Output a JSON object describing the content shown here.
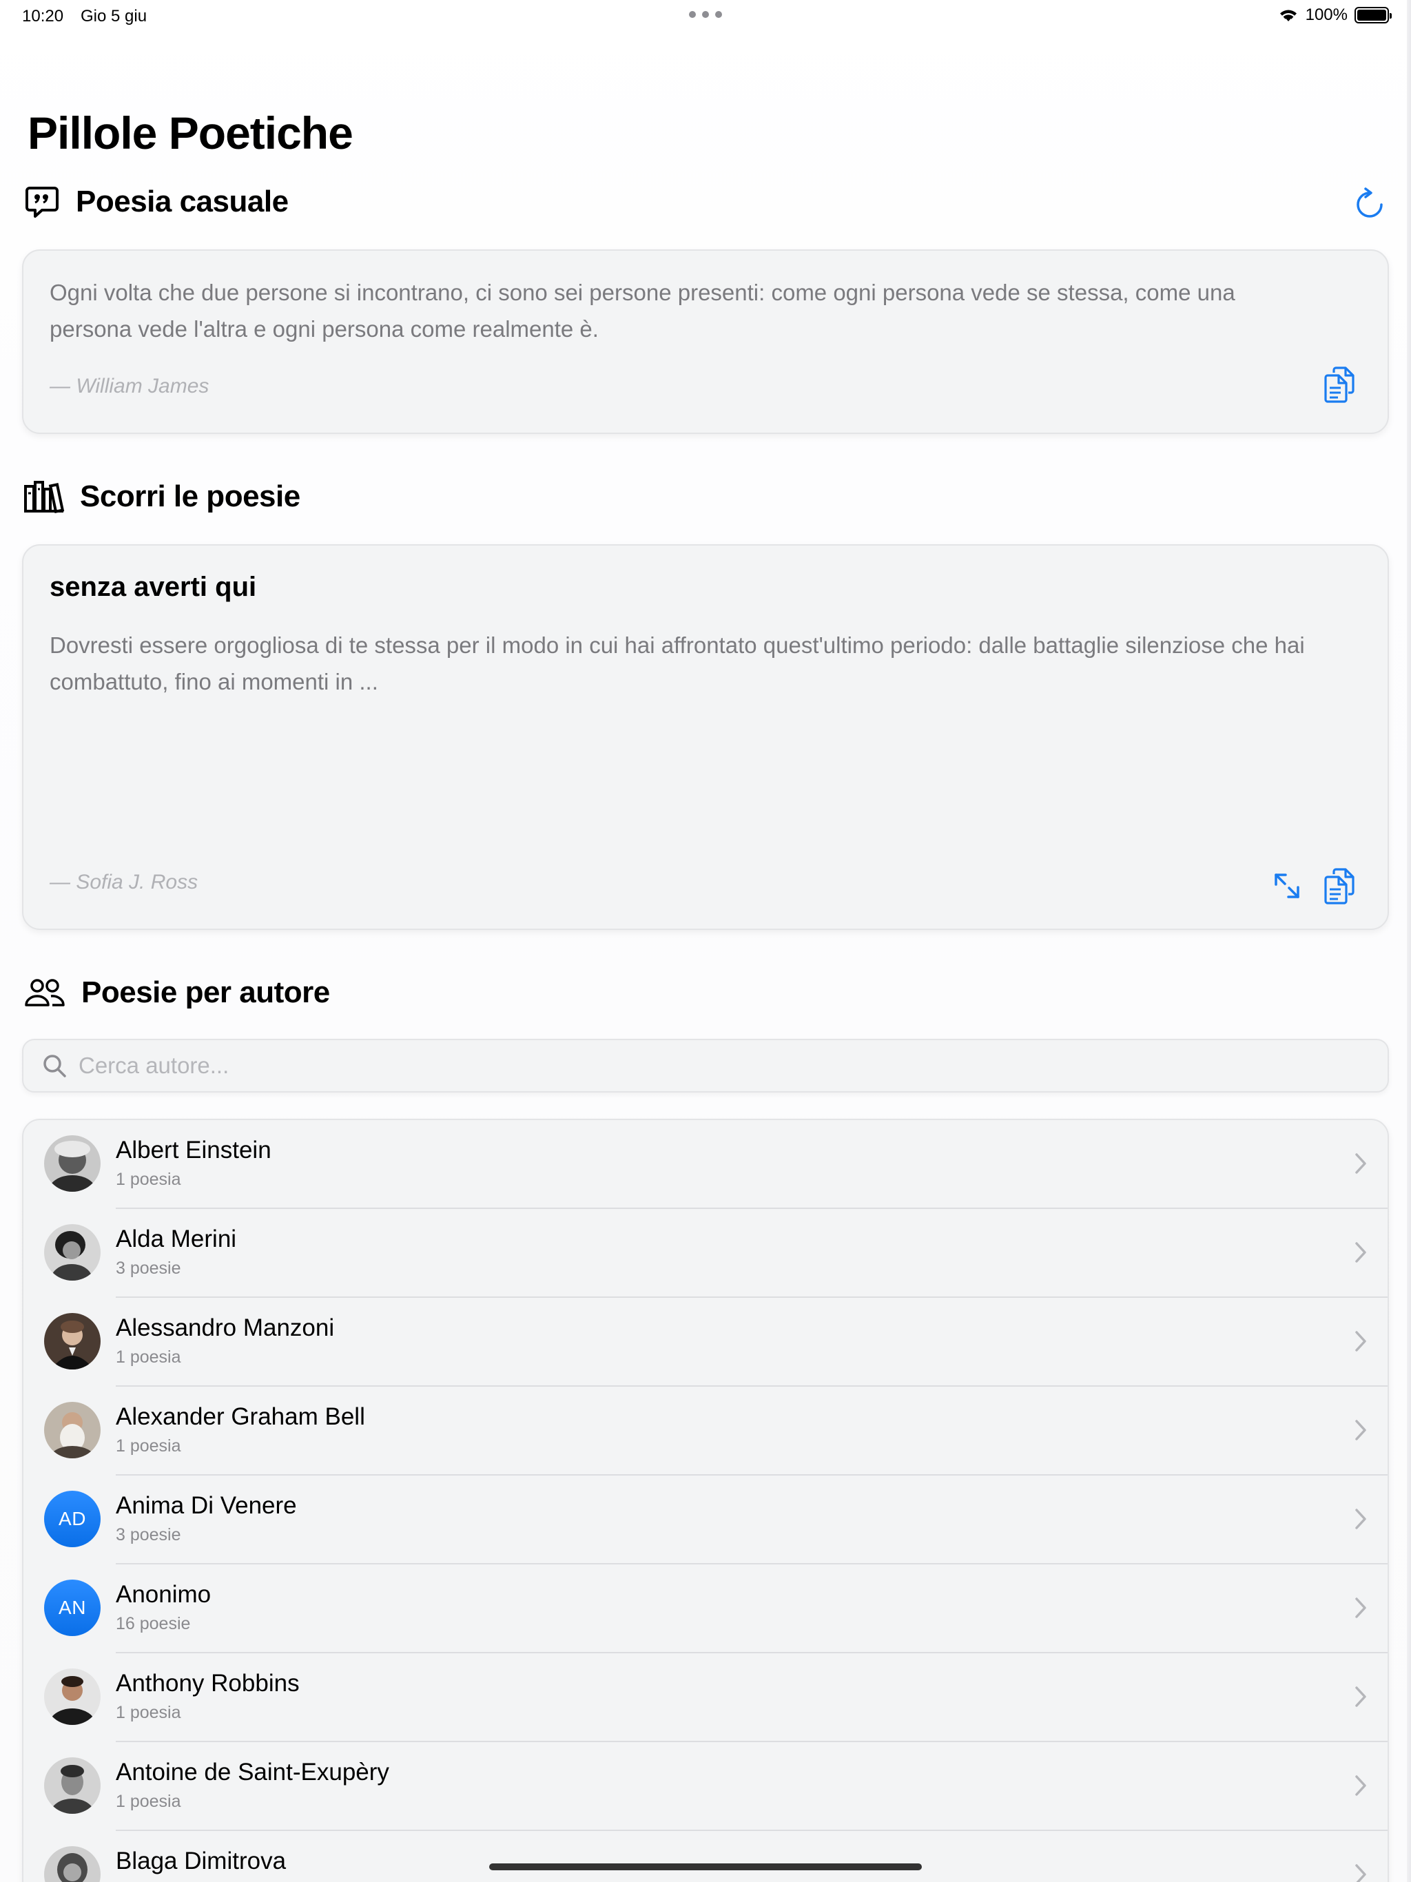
{
  "status_bar": {
    "time": "10:20",
    "date": "Gio 5 giu",
    "battery": "100%"
  },
  "app": {
    "title": "Pillole Poetiche"
  },
  "random_poem": {
    "section_title": "Poesia casuale",
    "text": "Ogni volta che due persone si incontrano, ci sono sei persone presenti: come ogni persona vede se stessa, come una persona vede l'altra e ogni persona come realmente è.",
    "author": "— William James",
    "icons": {
      "section": "quote-bubble-icon",
      "refresh": "refresh-icon",
      "copy": "copy-icon"
    }
  },
  "browse": {
    "section_title": "Scorri le poesie",
    "poem_title": "senza averti qui",
    "poem_text": "Dovresti essere orgogliosa di te stessa per il modo in cui hai affrontato quest'ultimo periodo: dalle battaglie silenziose che hai combattuto, fino ai momenti in ...",
    "author": "— Sofia J. Ross",
    "icons": {
      "section": "books-icon",
      "expand": "expand-icon",
      "copy": "copy-icon"
    }
  },
  "by_author": {
    "section_title": "Poesie per autore",
    "search_placeholder": "Cerca autore...",
    "icons": {
      "section": "people-icon",
      "search": "search-icon",
      "row": "chevron-right-icon"
    },
    "authors": [
      {
        "name": "Albert Einstein",
        "count": "1 poesia",
        "avatar": "photo"
      },
      {
        "name": "Alda Merini",
        "count": "3 poesie",
        "avatar": "photo"
      },
      {
        "name": "Alessandro Manzoni",
        "count": "1 poesia",
        "avatar": "photo"
      },
      {
        "name": "Alexander Graham Bell",
        "count": "1 poesia",
        "avatar": "photo"
      },
      {
        "name": "Anima Di Venere",
        "count": "3 poesie",
        "avatar": "initials",
        "initials": "AD"
      },
      {
        "name": "Anonimo",
        "count": "16 poesie",
        "avatar": "initials",
        "initials": "AN"
      },
      {
        "name": "Anthony Robbins",
        "count": "1 poesia",
        "avatar": "photo"
      },
      {
        "name": "Antoine de Saint-Exupèry",
        "count": "1 poesia",
        "avatar": "photo"
      },
      {
        "name": "Blaga Dimitrova",
        "count": "",
        "avatar": "photo"
      }
    ]
  },
  "colors": {
    "accent": "#1a7cf0",
    "card_bg": "#f3f4f5",
    "secondary_text": "#7a7a7e",
    "avatar_initials_bg": "#1a7cf0"
  }
}
